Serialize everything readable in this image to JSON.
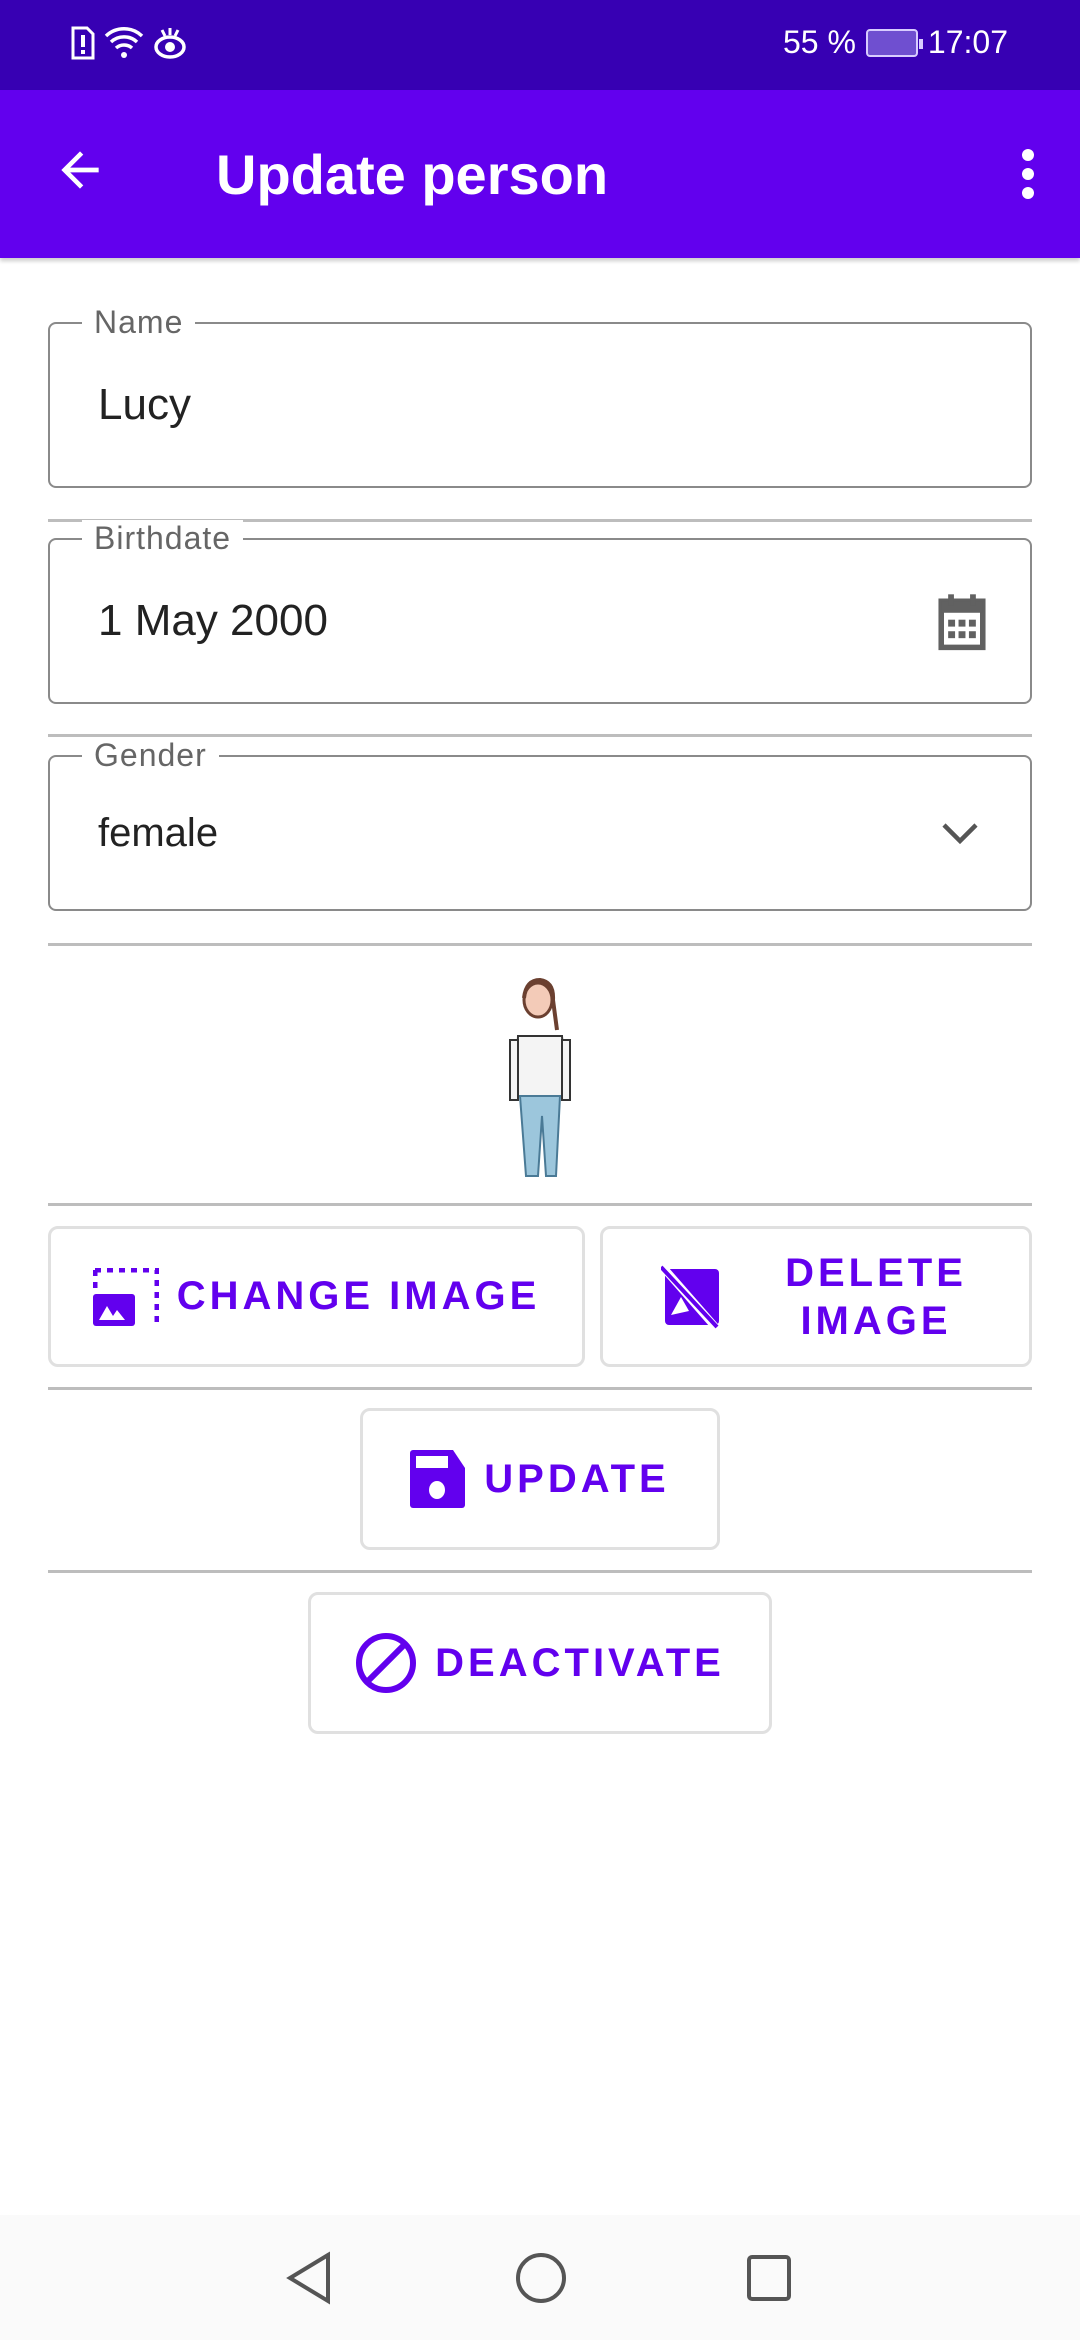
{
  "status_bar": {
    "battery": "55 %",
    "time": "17:07",
    "icons": [
      "sim-alert-icon",
      "wifi-icon",
      "eye-icon",
      "battery-charging-icon"
    ]
  },
  "app_bar": {
    "title": "Update person",
    "icons": [
      "back-arrow-icon",
      "more-vert-icon"
    ]
  },
  "form": {
    "name": {
      "label": "Name",
      "value": "Lucy"
    },
    "birthdate": {
      "label": "Birthdate",
      "value": "1 May 2000",
      "icon": "calendar-icon"
    },
    "gender": {
      "label": "Gender",
      "value": "female",
      "icon": "chevron-down-icon"
    }
  },
  "buttons": {
    "change_image": "CHANGE IMAGE",
    "delete_image": "DELETE IMAGE",
    "update": "UPDATE",
    "deactivate": "DEACTIVATE"
  },
  "colors": {
    "primary": "#6200ee",
    "primary_dark": "#3700b3"
  }
}
